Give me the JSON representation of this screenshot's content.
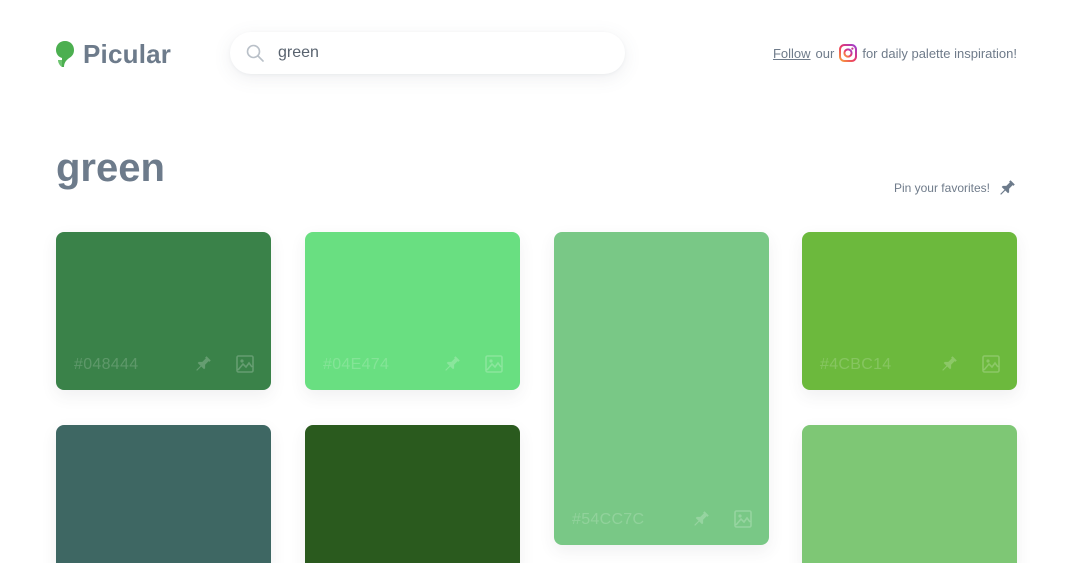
{
  "header": {
    "logo_text": "Picular",
    "search_value": "green",
    "search_placeholder": "",
    "promo_link": "Follow",
    "promo_mid": "our",
    "promo_tail": "for daily palette inspiration!"
  },
  "main": {
    "title": "green",
    "pin_hint": "Pin your favorites!"
  },
  "swatches": [
    {
      "hex": "#048444",
      "color": "#3a8249",
      "show_hex": true
    },
    {
      "hex": "#04E474",
      "color": "#69df81",
      "show_hex": true
    },
    {
      "hex": "#54CC7C",
      "color": "#79c886",
      "show_hex": true
    },
    {
      "hex": "#4CBC14",
      "color": "#6cb93d",
      "show_hex": true
    },
    {
      "hex": "",
      "color": "#3e6763",
      "show_hex": false
    },
    {
      "hex": "",
      "color": "#2a5a1e",
      "show_hex": false
    },
    {
      "hex": "",
      "color": "#7ec775",
      "show_hex": false
    }
  ],
  "icons": {
    "logo": "picular-logo-icon",
    "search": "search-icon",
    "instagram": "instagram-icon",
    "pin": "pin-icon",
    "image": "image-icon"
  },
  "colors": {
    "text": "#6f7b8a",
    "logo_green": "#4caf50"
  }
}
